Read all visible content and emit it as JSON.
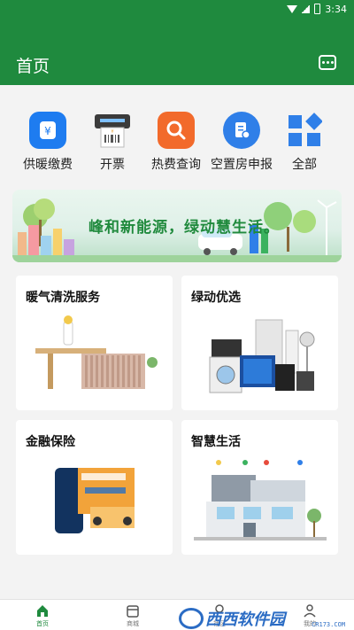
{
  "status_bar": {
    "time": "3:34"
  },
  "header": {
    "title": "首页",
    "message_icon": "message-dots-icon"
  },
  "quick_menu": [
    {
      "label": "供暖缴费",
      "icon": "heating-payment-icon",
      "color": "#1e7cf0"
    },
    {
      "label": "开票",
      "icon": "invoice-printer-icon",
      "color": "#4a4a4a"
    },
    {
      "label": "热费查询",
      "icon": "search-icon",
      "color": "#f26a2b"
    },
    {
      "label": "空置房申报",
      "icon": "vacant-report-icon",
      "color": "#2f7fe8"
    },
    {
      "label": "全部",
      "icon": "all-grid-icon",
      "color": "#2f7fe8"
    }
  ],
  "banner": {
    "text": "峰和新能源，绿动慧生活。"
  },
  "cards": [
    {
      "title": "暖气清洗服务",
      "image": "radiator-image"
    },
    {
      "title": "绿动优选",
      "image": "appliances-image"
    },
    {
      "title": "金融保险",
      "image": "finance-image"
    },
    {
      "title": "智慧生活",
      "image": "smart-home-image"
    }
  ],
  "bottom_nav": [
    {
      "label": "首页",
      "icon": "home-icon",
      "active": true
    },
    {
      "label": "商城",
      "icon": "store-icon",
      "active": false
    },
    {
      "label": "社区",
      "icon": "community-icon",
      "active": false
    },
    {
      "label": "我的",
      "icon": "profile-icon",
      "active": false
    }
  ],
  "watermark": {
    "text": "西西软件园",
    "sub": "CR173.COM"
  },
  "colors": {
    "primary": "#1f8a3e",
    "background": "#f3f3f3"
  }
}
